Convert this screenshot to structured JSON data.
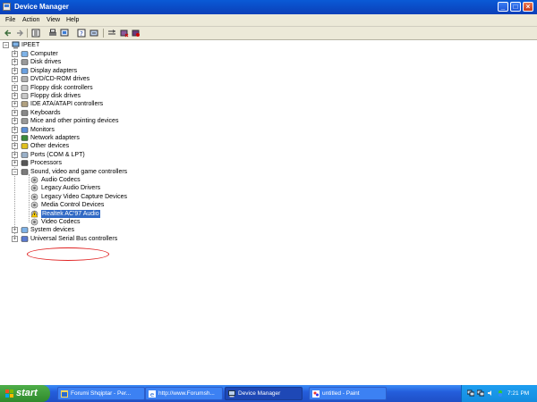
{
  "window": {
    "title": "Device Manager"
  },
  "menu": [
    "File",
    "Action",
    "View",
    "Help"
  ],
  "toolbar_icons": [
    "back-arrow-icon",
    "forward-arrow-icon",
    "properties-icon",
    "print-icon",
    "help-icon",
    "scan-hardware-icon",
    "update-driver-icon",
    "uninstall-icon",
    "disable-icon"
  ],
  "tree": {
    "root": "IPEET",
    "categories": [
      "Computer",
      "Disk drives",
      "Display adapters",
      "DVD/CD-ROM drives",
      "Floppy disk controllers",
      "Floppy disk drives",
      "IDE ATA/ATAPI controllers",
      "Keyboards",
      "Mice and other pointing devices",
      "Monitors",
      "Network adapters",
      "Other devices",
      "Ports (COM & LPT)",
      "Processors",
      "Sound, video and game controllers"
    ],
    "sound_children": [
      "Audio Codecs",
      "Legacy Audio Drivers",
      "Legacy Video Capture Devices",
      "Media Control Devices",
      "Realtek AC'97 Audio",
      "Video Codecs"
    ],
    "after": [
      "System devices",
      "Universal Serial Bus controllers"
    ],
    "selected": "Realtek AC'97 Audio"
  },
  "taskbar": {
    "start": "start",
    "tasks": [
      "Forumi Shqiptar - Per...",
      "http://www.Forumsh...",
      "Device Manager",
      "untitled - Paint"
    ],
    "active_task": "Device Manager",
    "clock": "7:21 PM"
  },
  "colors": {
    "selection": "#316ac5",
    "annotation": "#e02020",
    "titlebar": "#0b3fb8"
  }
}
